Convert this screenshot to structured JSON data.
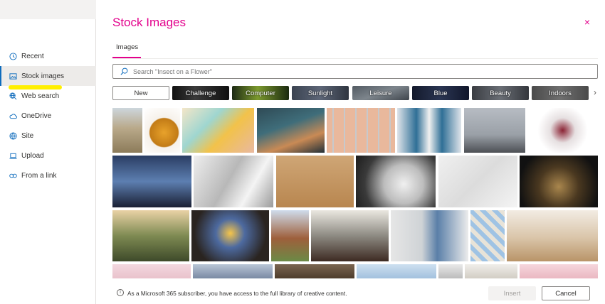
{
  "dialog": {
    "title": "Stock Images",
    "close_label": "×"
  },
  "sidebar": {
    "items": [
      {
        "label": "Recent",
        "icon": "clock-icon"
      },
      {
        "label": "Stock images",
        "icon": "image-icon",
        "active": true
      },
      {
        "label": "Web search",
        "icon": "globe-search-icon"
      },
      {
        "label": "OneDrive",
        "icon": "cloud-icon"
      },
      {
        "label": "Site",
        "icon": "globe-icon"
      },
      {
        "label": "Upload",
        "icon": "laptop-icon"
      },
      {
        "label": "From a link",
        "icon": "link-icon"
      }
    ]
  },
  "tabs": [
    {
      "label": "Images",
      "active": true
    }
  ],
  "search": {
    "placeholder": "Search \"Insect on a Flower\""
  },
  "categories": [
    {
      "label": "New"
    },
    {
      "label": "Challenge"
    },
    {
      "label": "Computer"
    },
    {
      "label": "Sunlight"
    },
    {
      "label": "Leisure"
    },
    {
      "label": "Blue"
    },
    {
      "label": "Beauty"
    },
    {
      "label": "Indoors"
    }
  ],
  "footer": {
    "info_text": "As a Microsoft 365 subscriber, you have access to the full library of creative content.",
    "insert_label": "Insert",
    "cancel_label": "Cancel"
  },
  "colors": {
    "accent": "#e3008c",
    "link_blue": "#0f6cbd",
    "highlight": "#ffef00"
  }
}
